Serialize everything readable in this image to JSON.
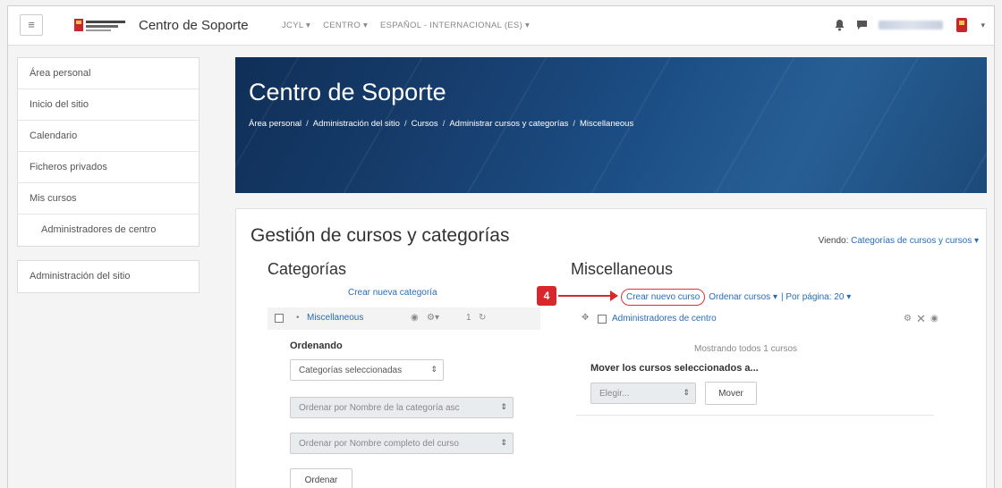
{
  "navbar": {
    "site_name": "Centro de Soporte",
    "menu": [
      "JCYL ▾",
      "CENTRO ▾",
      "ESPAÑOL - INTERNACIONAL (ES) ▾"
    ],
    "icons": [
      "menu-icon",
      "logo-junta",
      "notifications-icon",
      "messages-icon",
      "user-avatar",
      "caret-down-icon"
    ]
  },
  "sidebar": {
    "items": [
      {
        "label": "Área personal"
      },
      {
        "label": "Inicio del sitio"
      },
      {
        "label": "Calendario"
      },
      {
        "label": "Ficheros privados"
      },
      {
        "label": "Mis cursos"
      },
      {
        "label": "Administradores de centro"
      }
    ],
    "admin": "Administración del sitio"
  },
  "hero": {
    "title": "Centro de Soporte",
    "breadcrumb": [
      "Área personal",
      "Administración del sitio",
      "Cursos",
      "Administrar cursos y categorías",
      "Miscellaneous"
    ]
  },
  "main": {
    "page_title": "Gestión de cursos y categorías",
    "viewing_label": "Viendo:",
    "viewing_value": "Categorías de cursos y cursos ▾",
    "categories": {
      "heading": "Categorías",
      "new_link": "Crear nueva categoría",
      "row_name": "Miscellaneous",
      "row_count": "1",
      "sort_label": "Ordenando",
      "sort_select": "Categorías seleccionadas",
      "sort_by_name": "Ordenar por Nombre de la categoría asc",
      "sort_by_fullname": "Ordenar por Nombre completo del curso",
      "sort_button": "Ordenar"
    },
    "courses": {
      "heading": "Miscellaneous",
      "new_course": "Crear nuevo curso",
      "sort_courses": "Ordenar cursos ▾",
      "per_page": "| Por página: 20 ▾",
      "course_name": "Administradores de centro",
      "showing": "Mostrando todos 1 cursos",
      "move_label": "Mover los cursos seleccionados a...",
      "choose": "Elegir...",
      "move_button": "Mover"
    },
    "annotation": {
      "step": "4",
      "color": "#d9272e"
    }
  }
}
